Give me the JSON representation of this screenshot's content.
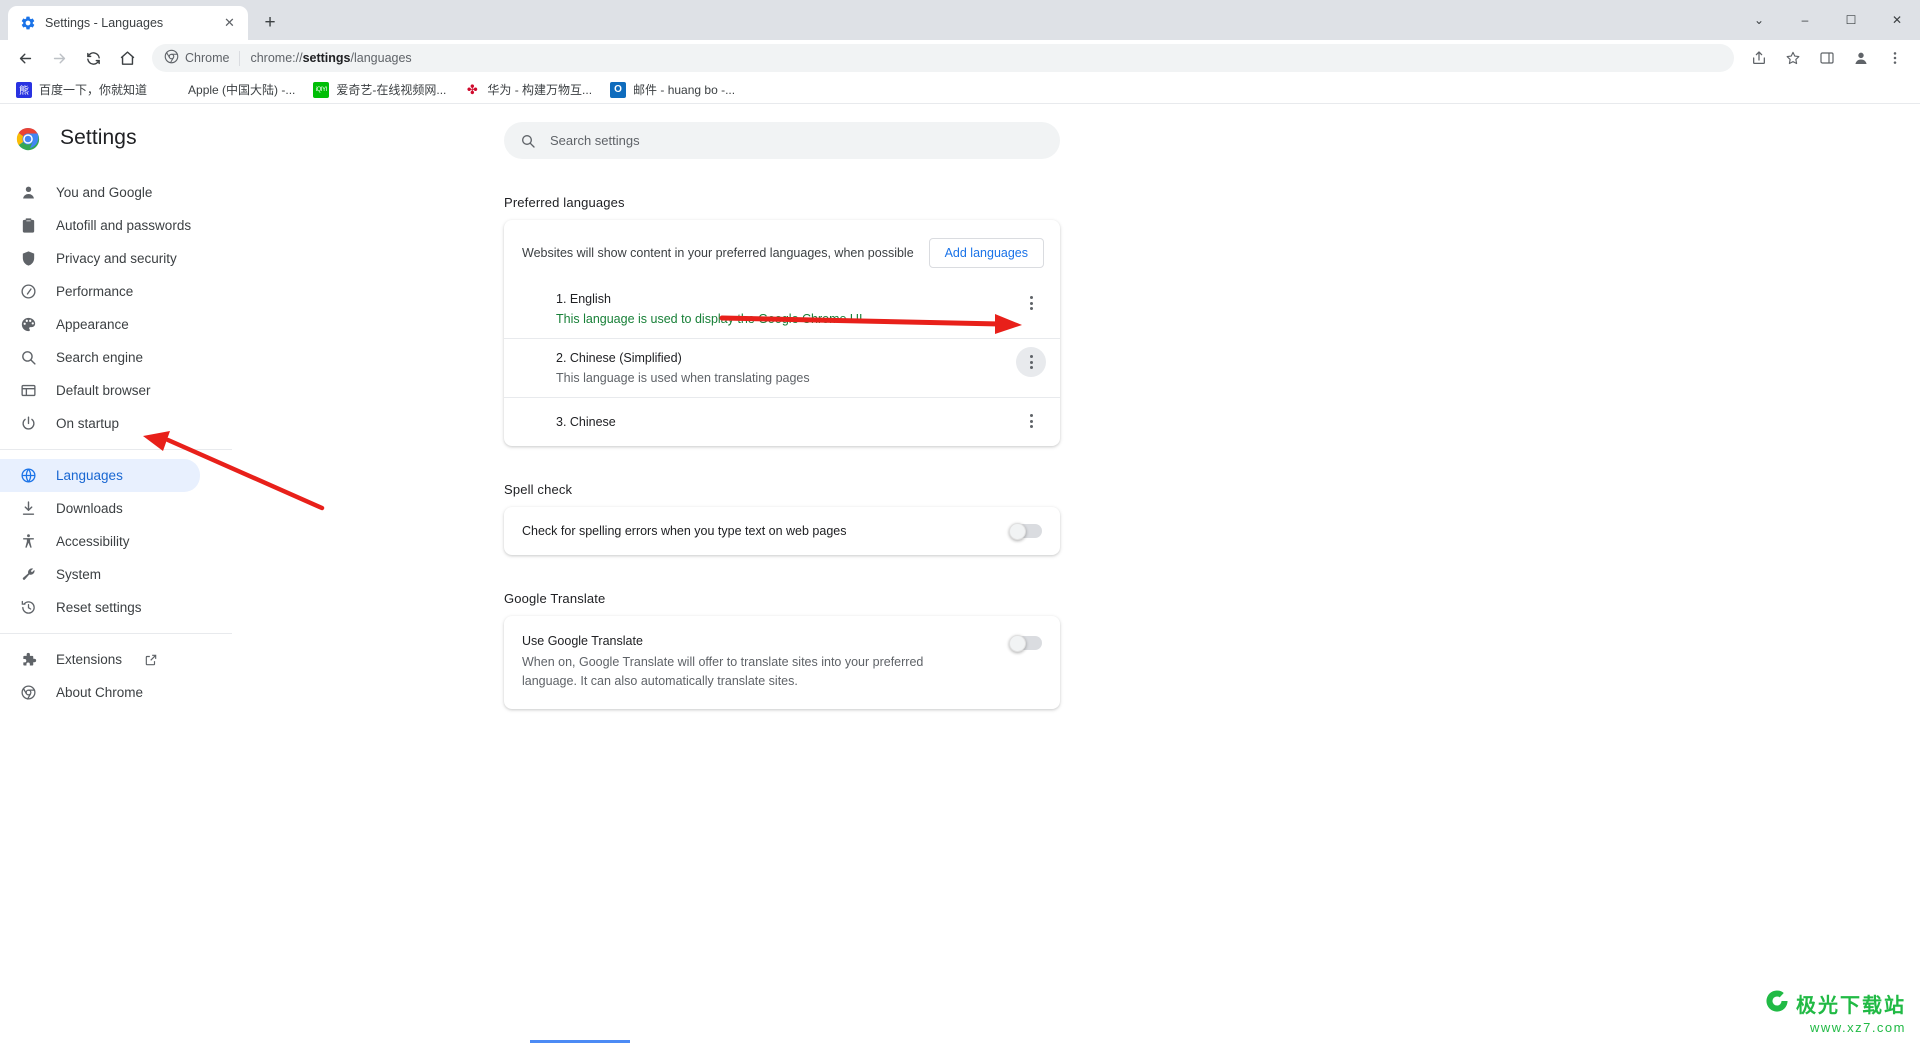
{
  "window": {
    "tab": {
      "title": "Settings - Languages",
      "favicon": "settings-gear-icon",
      "close": "✕"
    },
    "new_tab": "+",
    "controls": {
      "minimize_all": "⌄",
      "minimize": "–",
      "maximize": "☐",
      "close": "✕"
    }
  },
  "toolbar": {
    "back": "←",
    "forward": "→",
    "reload": "⟳",
    "home": "⌂",
    "omnibox": {
      "chip_label": "Chrome",
      "url_prefix": "chrome://",
      "url_bold": "settings",
      "url_suffix": "/languages"
    },
    "share": "share-icon",
    "bookmark_star": "☆",
    "side_panel": "side-panel-icon",
    "profile": "profile-avatar",
    "menu": "⋮"
  },
  "bookmarks": [
    {
      "label": "百度一下，你就知道",
      "icon": "baidu",
      "color": "#2932e1",
      "glyph": "百"
    },
    {
      "label": "Apple (中国大陆) -...",
      "icon": "apple",
      "color": "#555555",
      "glyph": ""
    },
    {
      "label": "爱奇艺-在线视频网...",
      "icon": "iqiyi",
      "color": "#00be06",
      "glyph": "iQIYI"
    },
    {
      "label": "华为 - 构建万物互...",
      "icon": "huawei",
      "color": "#cf0a2c",
      "glyph": "花"
    },
    {
      "label": "邮件 - huang bo -...",
      "icon": "outlook",
      "color": "#0f6cbd",
      "glyph": "O"
    }
  ],
  "sidebar": {
    "brand": "Settings",
    "items": [
      {
        "label": "You and Google",
        "icon": "person-icon",
        "selected": false
      },
      {
        "label": "Autofill and passwords",
        "icon": "clipboard-icon",
        "selected": false
      },
      {
        "label": "Privacy and security",
        "icon": "shield-icon",
        "selected": false
      },
      {
        "label": "Performance",
        "icon": "speedometer-icon",
        "selected": false
      },
      {
        "label": "Appearance",
        "icon": "palette-icon",
        "selected": false
      },
      {
        "label": "Search engine",
        "icon": "search-icon",
        "selected": false
      },
      {
        "label": "Default browser",
        "icon": "browser-window-icon",
        "selected": false
      },
      {
        "label": "On startup",
        "icon": "power-icon",
        "selected": false
      }
    ],
    "items2": [
      {
        "label": "Languages",
        "icon": "globe-icon",
        "selected": true
      },
      {
        "label": "Downloads",
        "icon": "download-icon",
        "selected": false
      },
      {
        "label": "Accessibility",
        "icon": "accessibility-icon",
        "selected": false
      },
      {
        "label": "System",
        "icon": "wrench-icon",
        "selected": false
      },
      {
        "label": "Reset settings",
        "icon": "history-restore-icon",
        "selected": false
      }
    ],
    "items3": [
      {
        "label": "Extensions",
        "icon": "puzzle-icon",
        "external": true,
        "selected": false
      },
      {
        "label": "About Chrome",
        "icon": "chrome-about-icon",
        "external": false,
        "selected": false
      }
    ]
  },
  "search": {
    "placeholder": "Search settings",
    "icon": "search-icon"
  },
  "main": {
    "preferred_languages": {
      "section_title": "Preferred languages",
      "description": "Websites will show content in your preferred languages, when possible",
      "add_button": "Add languages",
      "languages": [
        {
          "name": "1. English",
          "sub": "This language is used to display the Google Chrome UI",
          "sub_style": "green",
          "menu": "more-vertical-icon",
          "hovered": false
        },
        {
          "name": "2. Chinese (Simplified)",
          "sub": "This language is used when translating pages",
          "sub_style": "grey",
          "menu": "more-vertical-icon",
          "hovered": true
        },
        {
          "name": "3. Chinese",
          "sub": "",
          "sub_style": "grey",
          "menu": "more-vertical-icon",
          "hovered": false
        }
      ]
    },
    "spell_check": {
      "section_title": "Spell check",
      "row_label": "Check for spelling errors when you type text on web pages",
      "toggle_on": false
    },
    "google_translate": {
      "section_title": "Google Translate",
      "row_title": "Use Google Translate",
      "row_desc": "When on, Google Translate will offer to translate sites into your preferred language. It can also automatically translate sites.",
      "toggle_on": false
    }
  },
  "watermark": {
    "name": "极光下载站",
    "url": "www.xz7.com"
  },
  "colors": {
    "accent": "#1a73e8",
    "selected_bg": "#e8f0fe",
    "green": "#188038",
    "annotation": "#e8201a"
  }
}
